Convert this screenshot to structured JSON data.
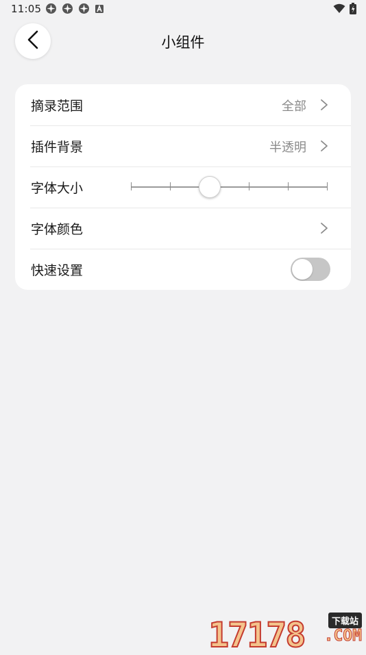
{
  "status_bar": {
    "time": "11:05",
    "left_icons": [
      "notification-icon",
      "notification-icon",
      "notification-icon",
      "a-badge-icon"
    ],
    "right_icons": [
      "wifi-icon",
      "battery-charging-icon"
    ]
  },
  "header": {
    "back_icon": "chevron-left-icon",
    "title": "小组件"
  },
  "settings": {
    "excerpt_range": {
      "label": "摘录范围",
      "value": "全部"
    },
    "widget_background": {
      "label": "插件背景",
      "value": "半透明"
    },
    "font_size": {
      "label": "字体大小",
      "tick_count": 6,
      "selected_index": 2
    },
    "font_color": {
      "label": "字体颜色"
    },
    "quick_settings": {
      "label": "快速设置",
      "enabled": false
    }
  },
  "watermark": {
    "number": "17178",
    "tag": "下载站",
    "domain": ".COM"
  },
  "colors": {
    "background": "#f2f2f3",
    "card": "#ffffff",
    "secondary_text": "#8a8a8a",
    "toggle_off": "#c6c6c6"
  }
}
